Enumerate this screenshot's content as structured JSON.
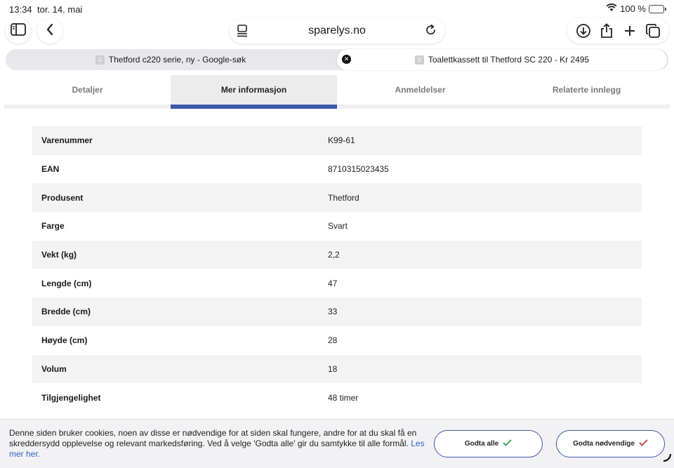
{
  "status": {
    "time": "13:34",
    "date": "tor. 14. mai",
    "battery": "100 %"
  },
  "address": {
    "domain": "sparelys.no"
  },
  "tabs": [
    {
      "label": "Thetford c220 serie, ny - Google-søk",
      "favicon": "G"
    },
    {
      "label": "Toalettkassett til Thetford SC 220 - Kr 2495",
      "favicon": "S"
    }
  ],
  "page_tabs": [
    "Detaljer",
    "Mer informasjon",
    "Anmeldelser",
    "Relaterte innlegg"
  ],
  "specs": [
    {
      "k": "Varenummer",
      "v": "K99-61"
    },
    {
      "k": "EAN",
      "v": "8710315023435"
    },
    {
      "k": "Produsent",
      "v": "Thetford"
    },
    {
      "k": "Farge",
      "v": "Svart"
    },
    {
      "k": "Vekt (kg)",
      "v": "2,2"
    },
    {
      "k": "Lengde (cm)",
      "v": "47"
    },
    {
      "k": "Bredde (cm)",
      "v": "33"
    },
    {
      "k": "Høyde (cm)",
      "v": "28"
    },
    {
      "k": "Volum",
      "v": "18"
    },
    {
      "k": "Tilgjengelighet",
      "v": "48 timer"
    }
  ],
  "cookie": {
    "text": "Denne siden bruker cookies, noen av disse er nødvendige for at siden skal fungere, andre for at du skal få en skreddersydd opplevelse og relevant markedsføring. Ved å velge 'Godta alle' gir du samtykke til alle formål.",
    "link": "Les mer her.",
    "accept_all": "Godta alle",
    "accept_necessary": "Godta nødvendige"
  },
  "colors": {
    "accent": "#3b5aa8",
    "link": "#2b62c7",
    "battery": "#34c759"
  }
}
